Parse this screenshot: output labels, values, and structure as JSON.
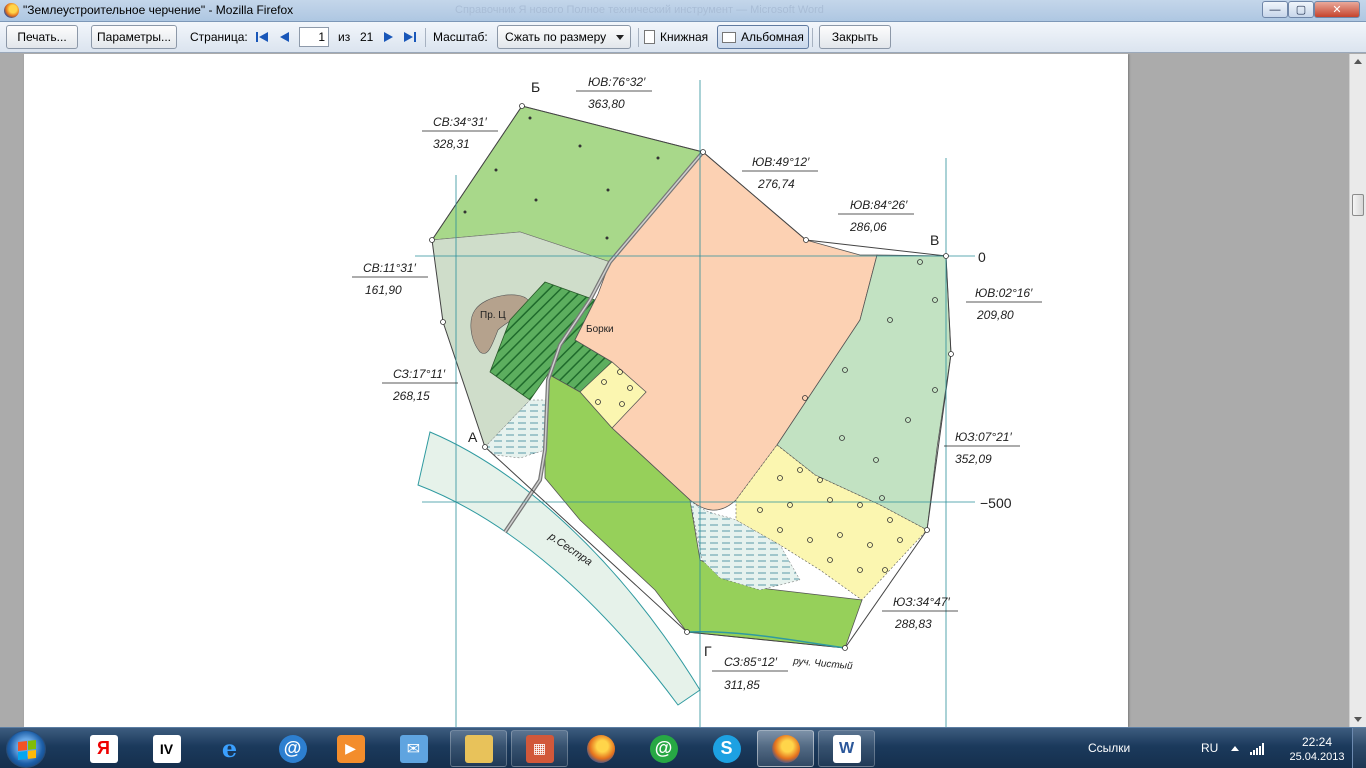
{
  "window": {
    "title": "\"Землеустроительное черчение\" - Mozilla Firefox",
    "ghost_title": "Справочник Я нового Полное технический инструмент — Microsoft Word",
    "controls": {
      "minimize": "—",
      "maximize": "▢",
      "close": "✕"
    }
  },
  "toolbar": {
    "print": "Печать...",
    "settings": "Параметры...",
    "page_label": "Страница:",
    "page_current": "1",
    "page_of": "из",
    "page_total": "21",
    "scale_label": "Масштаб:",
    "scale_value": "Сжать по размеру",
    "portrait": "Книжная",
    "landscape": "Альбомная",
    "close": "Закрыть"
  },
  "map": {
    "points": {
      "b": "Б",
      "v": "В",
      "a": "А",
      "g": "Г"
    },
    "grid_labels": {
      "zero": "0",
      "minus500": "−500"
    },
    "places": {
      "borki": "Борки",
      "pond": "Пр. Ц",
      "river": "р.Сестра",
      "stream": "руч. Чистый"
    },
    "bearings": [
      {
        "dir": "ЮВ:76°32′",
        "dist": "363,80"
      },
      {
        "dir": "СВ:34°31′",
        "dist": "328,31"
      },
      {
        "dir": "ЮВ:49°12′",
        "dist": "276,74"
      },
      {
        "dir": "ЮВ:84°26′",
        "dist": "286,06"
      },
      {
        "dir": "СВ:11°31′",
        "dist": "161,90"
      },
      {
        "dir": "ЮВ:02°16′",
        "dist": "209,80"
      },
      {
        "dir": "СЗ:17°11′",
        "dist": "268,15"
      },
      {
        "dir": "ЮЗ:07°21′",
        "dist": "352,09"
      },
      {
        "dir": "ЮЗ:34°47′",
        "dist": "288,83"
      },
      {
        "dir": "СЗ:85°12′",
        "dist": "311,85"
      }
    ],
    "colors": {
      "forest": "#a8d88a",
      "meadow_light": "#d2e4c2",
      "arable": "#fcd1b3",
      "shrub": "#c2e2c2",
      "field": "#96d05a",
      "orchard": "#fbf6b0",
      "hatched": "#3f9a4c",
      "pond": "#b5a28d",
      "river": "#e6f2ea",
      "grid": "#2a8f9a"
    }
  },
  "taskbar": {
    "links": "Ссылки",
    "lang": "RU",
    "time": "22:24",
    "date": "25.04.2013",
    "apps": [
      "yandex-icon",
      "iv-icon",
      "ie-icon",
      "mail-at-icon",
      "media-icon",
      "mail-icon",
      "explorer-icon",
      "photo-icon",
      "firefox-icon",
      "agent-icon",
      "skype-icon",
      "firefox-icon",
      "word-icon"
    ]
  }
}
